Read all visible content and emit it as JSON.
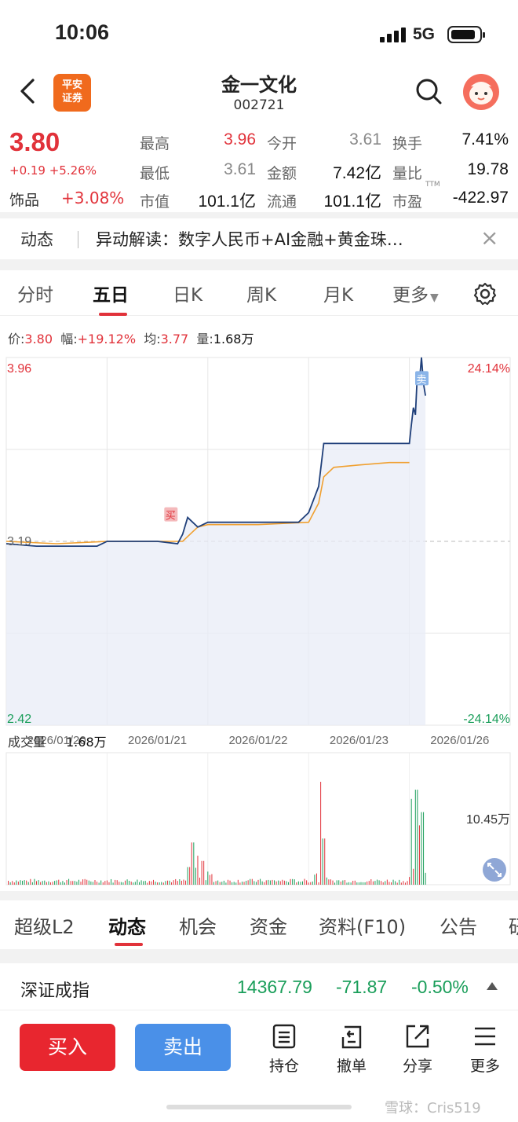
{
  "status_bar": {
    "time": "10:06",
    "network": "5G"
  },
  "header": {
    "broker_logo_line1": "平安",
    "broker_logo_line2": "证券",
    "title": "金一文化",
    "code": "002721"
  },
  "quote": {
    "price": "3.80",
    "change": "+0.19 +5.26%",
    "sector_name": "饰品",
    "sector_change": "+3.08%",
    "rows": [
      [
        {
          "label": "最高",
          "value": "3.96",
          "color": "red"
        },
        {
          "label": "今开",
          "value": "3.61",
          "color": "gray"
        },
        {
          "label": "换手",
          "value": "7.41%",
          "color": "dark"
        }
      ],
      [
        {
          "label": "最低",
          "value": "3.61",
          "color": "gray"
        },
        {
          "label": "金额",
          "value": "7.42亿",
          "color": "dark"
        },
        {
          "label": "量比",
          "value": "19.78",
          "color": "dark"
        }
      ],
      [
        {
          "label": "市值",
          "value": "101.1亿",
          "color": "dark"
        },
        {
          "label": "流通",
          "value": "101.1亿",
          "color": "dark"
        },
        {
          "label": "市盈",
          "value": "-422.97",
          "color": "dark"
        }
      ]
    ],
    "ttm_label": "TTM"
  },
  "news": {
    "tag": "动态",
    "text": "异动解读：数字人民币+AI金融+黄金珠…"
  },
  "chart_tabs": {
    "items": [
      "分时",
      "五日",
      "日K",
      "周K",
      "月K",
      "更多"
    ],
    "active": "五日"
  },
  "stats": {
    "price_label": "价:",
    "price": "3.80",
    "range_label": "幅:",
    "range": "+19.12%",
    "avg_label": "均:",
    "avg": "3.77",
    "vol_label": "量:",
    "vol": "1.68万"
  },
  "chart_data": {
    "type": "line",
    "y_left_top": "3.96",
    "y_left_bottom": "2.42",
    "y_prev_close": "3.19",
    "y_right_top": "24.14%",
    "y_right_bottom": "-24.14%",
    "ylim": [
      2.42,
      3.96
    ],
    "prev_close": 3.19,
    "dates": [
      "2026/01/20",
      "2026/01/21",
      "2026/01/22",
      "2026/01/23",
      "2026/01/26"
    ],
    "series": [
      {
        "x": [
          0,
          0.3,
          0.6,
          0.9,
          1.0,
          1.2,
          1.5,
          1.7,
          1.75,
          1.8,
          1.85,
          1.9,
          2.0,
          2.3,
          2.6,
          2.9,
          3.0,
          3.1,
          3.15,
          3.2,
          3.5,
          3.8,
          4.0,
          4.02,
          4.04,
          4.06,
          4.08,
          4.1,
          4.12,
          4.14,
          4.16
        ],
        "values": [
          3.18,
          3.17,
          3.17,
          3.17,
          3.19,
          3.19,
          3.19,
          3.18,
          3.22,
          3.29,
          3.27,
          3.25,
          3.27,
          3.27,
          3.27,
          3.27,
          3.31,
          3.42,
          3.6,
          3.6,
          3.6,
          3.6,
          3.6,
          3.68,
          3.75,
          3.72,
          3.9,
          3.86,
          3.96,
          3.85,
          3.8
        ]
      },
      {
        "x": [
          0,
          0.5,
          1.0,
          1.5,
          1.75,
          1.85,
          1.9,
          2.0,
          2.5,
          3.0,
          3.1,
          3.15,
          3.25,
          3.5,
          3.8,
          4.0
        ],
        "values": [
          3.19,
          3.18,
          3.19,
          3.19,
          3.19,
          3.23,
          3.25,
          3.26,
          3.26,
          3.27,
          3.35,
          3.46,
          3.5,
          3.51,
          3.52,
          3.52
        ]
      }
    ],
    "markers": [
      {
        "label": "买"
      },
      {
        "label": "卖"
      }
    ],
    "volume_label": "成交量",
    "volume_value": "1.68万",
    "volume_max_label": "10.45万"
  },
  "bottom_tabs": {
    "items": [
      "超级L2",
      "动态",
      "机会",
      "资金",
      "资料(F10)",
      "公告",
      "研"
    ],
    "active": "动态"
  },
  "index": {
    "name": "深证成指",
    "value": "14367.79",
    "change": "-71.87",
    "pct": "-0.50%"
  },
  "actions": {
    "buy": "买入",
    "sell": "卖出",
    "items": [
      {
        "label": "持仓",
        "icon": "holdings-icon"
      },
      {
        "label": "撤单",
        "icon": "cancel-order-icon"
      },
      {
        "label": "分享",
        "icon": "share-icon"
      },
      {
        "label": "更多",
        "icon": "more-icon"
      }
    ]
  },
  "watermark": "雪球：Cris519",
  "colors": {
    "red": "#e1323a",
    "green": "#1a9e5a",
    "price_line": "#1f3f7a",
    "avg_line": "#f0a030",
    "buy_btn": "#e8262f",
    "sell_btn": "#4a90e8"
  }
}
